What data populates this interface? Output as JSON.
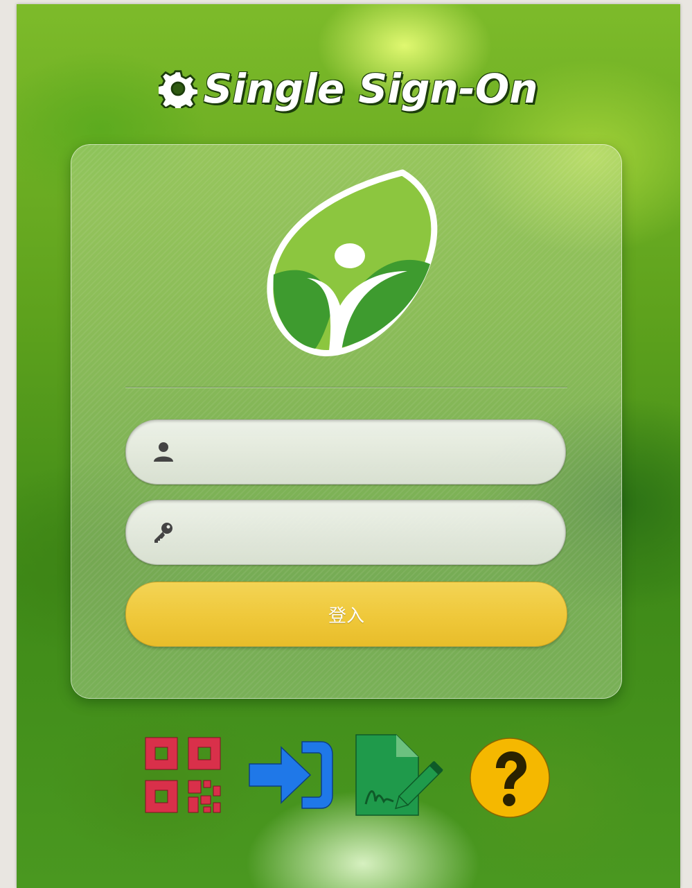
{
  "header": {
    "title": "Single Sign-On",
    "icon": "gear-icon"
  },
  "logo": {
    "icon": "leaf-person-logo",
    "colors": {
      "leaf": "#8cc63f",
      "dark": "#3e9b2f",
      "figure": "#ffffff"
    }
  },
  "form": {
    "username": {
      "icon": "user-icon",
      "value": "",
      "placeholder": ""
    },
    "password": {
      "icon": "key-icon",
      "value": "",
      "placeholder": ""
    },
    "login_label": "登入"
  },
  "actions": [
    {
      "icon": "qr-code-icon",
      "color": "#d9304a"
    },
    {
      "icon": "sign-in-icon",
      "color": "#1f78e8"
    },
    {
      "icon": "document-sign-icon",
      "color": "#1f9a4b"
    },
    {
      "icon": "help-icon",
      "color": "#f5b800"
    }
  ]
}
